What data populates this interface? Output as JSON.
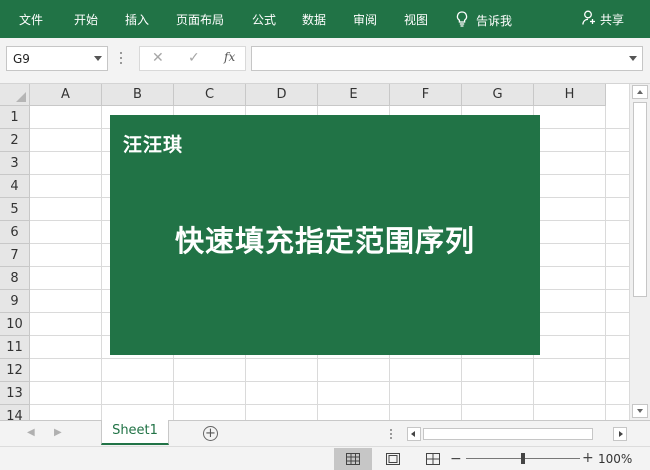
{
  "ribbon": {
    "tabs": [
      "文件",
      "开始",
      "插入",
      "页面布局",
      "公式",
      "数据",
      "审阅",
      "视图"
    ],
    "tell_me": "告诉我",
    "share": "共享",
    "icons": {
      "tell_me": "lightbulb-icon",
      "share": "person-icon"
    },
    "color": "#217346"
  },
  "formula_bar": {
    "name_box": "G9",
    "cancel_icon": "✕",
    "enter_icon": "✓",
    "fx": "fx",
    "formula_value": ""
  },
  "grid": {
    "columns": [
      "A",
      "B",
      "C",
      "D",
      "E",
      "F",
      "G",
      "H"
    ],
    "rows": [
      "1",
      "2",
      "3",
      "4",
      "5",
      "6",
      "7",
      "8",
      "9",
      "10",
      "11",
      "12",
      "13",
      "14"
    ]
  },
  "banner": {
    "author": "汪汪琪",
    "title": "快速填充指定范围序列",
    "color": "#217346"
  },
  "sheets": {
    "tabs": [
      "Sheet1"
    ],
    "active": "Sheet1",
    "add_label": "+"
  },
  "status": {
    "zoom_minus": "−",
    "zoom_plus": "+",
    "zoom_level": "100%",
    "zoom_fraction": 0.5
  }
}
